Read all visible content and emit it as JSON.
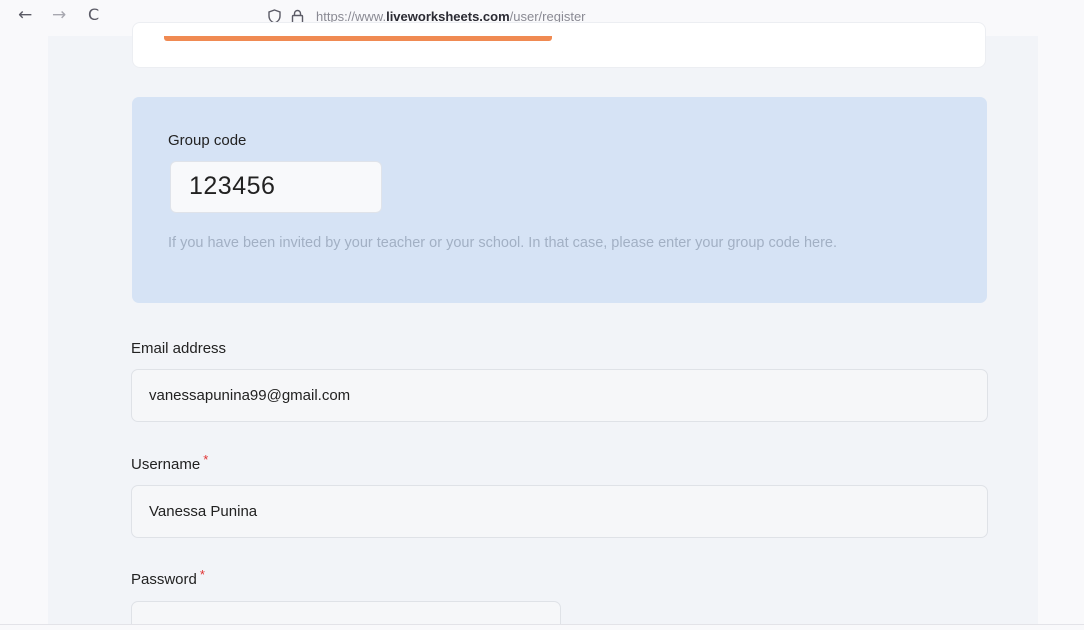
{
  "browser": {
    "back_glyph": "←",
    "forward_glyph": "→",
    "reload_glyph": "C",
    "url_prefix": "https://www.",
    "url_domain": "liveworksheets.com",
    "url_path": "/user/register"
  },
  "form": {
    "group_code": {
      "label": "Group code",
      "value": "123456",
      "help_text": "If you have been invited by your teacher or your school. In that case, please enter your group code here."
    },
    "email": {
      "label": "Email address",
      "value": "vanessapunina99@gmail.com"
    },
    "username": {
      "label": "Username",
      "required_mark": "*",
      "value": "Vanessa Punina"
    },
    "password": {
      "label": "Password",
      "required_mark": "*"
    }
  },
  "colors": {
    "accent_orange": "#f08a52",
    "group_box_bg": "#d6e3f5",
    "required": "#e03131"
  }
}
